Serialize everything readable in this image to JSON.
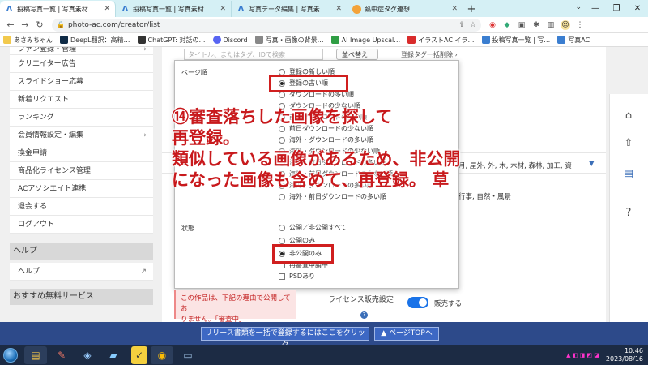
{
  "tabs": [
    {
      "label": "投稿写真一覧 | 写真素材なら「",
      "icon": "photoac-icon",
      "active": true
    },
    {
      "label": "投稿写真一覧 | 写真素材なら「",
      "icon": "photoac-icon",
      "active": false
    },
    {
      "label": "写真データ編集 | 写真素材なら",
      "icon": "photoac-icon",
      "active": false
    },
    {
      "label": "熱中症タグ連想",
      "icon": "openai-icon",
      "active": false
    }
  ],
  "address": {
    "url": "photo-ac.com/creator/list"
  },
  "bookmarks": [
    {
      "label": "あさみちゃん",
      "color": "#f2c94c"
    },
    {
      "label": "DeepL翻訳：高精…",
      "color": "#0f2b46"
    },
    {
      "label": "ChatGPT: 対話の…",
      "color": "#333333"
    },
    {
      "label": "Discord",
      "color": "#5865f2"
    },
    {
      "label": "写真・画像の背景…",
      "color": "#888888"
    },
    {
      "label": "AI Image Upscal…",
      "color": "#2f9e44"
    },
    {
      "label": "イラストAC イラ…",
      "color": "#d92b2b"
    },
    {
      "label": "投稿写真一覧 | 写…",
      "color": "#3b7ed0"
    },
    {
      "label": "写真AC",
      "color": "#3b7ed0"
    }
  ],
  "sidebar": {
    "items": [
      {
        "label": "ファン登録・管理",
        "chevron": "›"
      },
      {
        "label": "クリエイター広告",
        "chevron": ""
      },
      {
        "label": "スライドショー応募",
        "chevron": ""
      },
      {
        "label": "新着リクエスト",
        "chevron": ""
      },
      {
        "label": "ランキング",
        "chevron": ""
      },
      {
        "label": "会員情報設定・編集",
        "chevron": "›"
      },
      {
        "label": "換金申請",
        "chevron": ""
      },
      {
        "label": "商品化ライセンス管理",
        "chevron": ""
      },
      {
        "label": "ACアソシエイト連携",
        "chevron": ""
      },
      {
        "label": "退会する",
        "chevron": ""
      },
      {
        "label": "ログアウト",
        "chevron": ""
      }
    ],
    "help_header": "ヘルプ",
    "help_item": "ヘルプ",
    "recommend_header": "おすすめ無料サービス"
  },
  "toolbar": {
    "search_placeholder": "タイトル、またはタグ、IDで検索",
    "sort_label": "並べ替え",
    "tag_bulk_delete": "登録タグ一括削除 ›"
  },
  "background_text": {
    "tags_row": "月, 屋外, 外, 木, 木材, 森林, 加工, 資",
    "tags_row2": "行事, 自然・風景"
  },
  "dropdown": {
    "section_sort": "ページ順",
    "sort_options": [
      {
        "label": "登録の新しい順",
        "selected": false
      },
      {
        "label": "登録の古い順",
        "selected": true
      },
      {
        "label": "ダウンロードの多い順",
        "selected": false
      },
      {
        "label": "ダウンロードの少ない順",
        "selected": false
      },
      {
        "label": "前日ダウンロードの多い順",
        "selected": false
      },
      {
        "label": "前日ダウンロードの少ない順",
        "selected": false
      },
      {
        "label": "海外・ダウンロードの多い順",
        "selected": false
      },
      {
        "label": "海外・ダウンロードの少ない順",
        "selected": false
      },
      {
        "label": "海外・前日ダウンロードの多い順",
        "selected": false
      },
      {
        "label": "海外・前日ダウンロードの少ない順",
        "selected": false
      },
      {
        "label": "海外・ダウンロードの多い順",
        "selected": false
      },
      {
        "label": "海外・前日ダウンロードの多い順",
        "selected": false
      }
    ],
    "section_status": "状態",
    "status_options": [
      {
        "label": "公開／非公開すべて",
        "type": "radio",
        "selected": false
      },
      {
        "label": "公開のみ",
        "type": "radio",
        "selected": false
      },
      {
        "label": "非公開のみ",
        "type": "radio",
        "selected": true
      },
      {
        "label": "再審査申請中",
        "type": "check",
        "selected": false
      },
      {
        "label": "PSDあり",
        "type": "check",
        "selected": false
      }
    ]
  },
  "annotation": {
    "line1": "⑭審査落ちした画像を探して",
    "line2": "再登録。",
    "line3": "類似している画像があるため、非公開",
    "line4": "になった画像も含めて、再登録。 草"
  },
  "warning": {
    "text1": "この作品は、下記の理由で公開してお",
    "text2": "りません。「審査中」"
  },
  "license": {
    "label": "ライセンス販売設定",
    "toggle_label": "販売する",
    "toggle_on": true
  },
  "bottom_bar": {
    "bulk_register": "リリース書類を一括で登録するにはここをクリック",
    "page_top": "▲ ページTOPへ"
  },
  "taskbar": {
    "time": "10:46",
    "date": "2023/08/16"
  },
  "colors": {
    "annotation_red": "#c8191c",
    "highlight_box": "#d01f1f",
    "bottom_bar": "#2d4a8a",
    "toggle_blue": "#1a73e8"
  }
}
